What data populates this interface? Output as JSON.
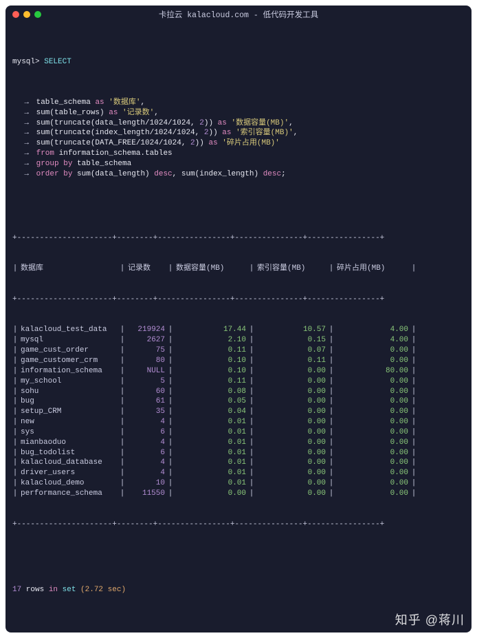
{
  "window": {
    "title": "卡拉云 kalacloud.com - 低代码开发工具"
  },
  "prompt": {
    "label": "mysql>",
    "keyword_select": "SELECT",
    "lines": [
      {
        "left": "table_schema ",
        "kw": "as",
        "lit": " '数据库'",
        "tail": ","
      },
      {
        "left": "sum(table_rows) ",
        "kw": "as",
        "lit": " '记录数'",
        "tail": ","
      },
      {
        "left": "sum(truncate(data_length/1024/1024, ",
        "num": "2",
        "mid": ")) ",
        "kw": "as",
        "lit": " '数据容量(MB)'",
        "tail": ","
      },
      {
        "left": "sum(truncate(index_length/1024/1024, ",
        "num": "2",
        "mid": ")) ",
        "kw": "as",
        "lit": " '索引容量(MB)'",
        "tail": ","
      },
      {
        "left": "sum(truncate(DATA_FREE/1024/1024, ",
        "num": "2",
        "mid": ")) ",
        "kw": "as",
        "lit": " '碎片占用(MB)'",
        "tail": ""
      },
      {
        "kw": "from",
        "rest": " information_schema.tables"
      },
      {
        "kw": "group by",
        "rest": " table_schema"
      },
      {
        "kw": "order by",
        "rest_a": " sum(data_length) ",
        "kw2": "desc",
        "rest_b": ", sum(index_length) ",
        "kw3": "desc",
        "tail": ";"
      }
    ]
  },
  "table": {
    "headers": {
      "db": "数据库",
      "rows": "记录数",
      "data": "数据容量(MB)",
      "index": "索引容量(MB)",
      "frag": "碎片占用(MB)"
    },
    "rows": [
      {
        "db": "kalacloud_test_data",
        "rows": "219924",
        "data": "17.44",
        "index": "10.57",
        "frag": "4.00"
      },
      {
        "db": "mysql",
        "rows": "2627",
        "data": "2.10",
        "index": "0.15",
        "frag": "4.00"
      },
      {
        "db": "game_cust_order",
        "rows": "75",
        "data": "0.11",
        "index": "0.07",
        "frag": "0.00"
      },
      {
        "db": "game_customer_crm",
        "rows": "80",
        "data": "0.10",
        "index": "0.11",
        "frag": "0.00"
      },
      {
        "db": "information_schema",
        "rows": "NULL",
        "data": "0.10",
        "index": "0.00",
        "frag": "80.00"
      },
      {
        "db": "my_school",
        "rows": "5",
        "data": "0.11",
        "index": "0.00",
        "frag": "0.00"
      },
      {
        "db": "sohu",
        "rows": "60",
        "data": "0.08",
        "index": "0.00",
        "frag": "0.00"
      },
      {
        "db": "bug",
        "rows": "61",
        "data": "0.05",
        "index": "0.00",
        "frag": "0.00"
      },
      {
        "db": "setup_CRM",
        "rows": "35",
        "data": "0.04",
        "index": "0.00",
        "frag": "0.00"
      },
      {
        "db": "new",
        "rows": "4",
        "data": "0.01",
        "index": "0.00",
        "frag": "0.00"
      },
      {
        "db": "sys",
        "rows": "6",
        "data": "0.01",
        "index": "0.00",
        "frag": "0.00"
      },
      {
        "db": "mianbaoduo",
        "rows": "4",
        "data": "0.01",
        "index": "0.00",
        "frag": "0.00"
      },
      {
        "db": "bug_todolist",
        "rows": "6",
        "data": "0.01",
        "index": "0.00",
        "frag": "0.00"
      },
      {
        "db": "kalacloud_database",
        "rows": "4",
        "data": "0.01",
        "index": "0.00",
        "frag": "0.00"
      },
      {
        "db": "driver_users",
        "rows": "4",
        "data": "0.01",
        "index": "0.00",
        "frag": "0.00"
      },
      {
        "db": "kalacloud_demo",
        "rows": "10",
        "data": "0.01",
        "index": "0.00",
        "frag": "0.00"
      },
      {
        "db": "performance_schema",
        "rows": "11550",
        "data": "0.00",
        "index": "0.00",
        "frag": "0.00"
      }
    ]
  },
  "summary": {
    "count": "17",
    "word_rows": " rows ",
    "word_in": "in",
    "word_set": " set ",
    "time": "(2.72 sec)"
  },
  "watermark": "知乎 @蒋川"
}
